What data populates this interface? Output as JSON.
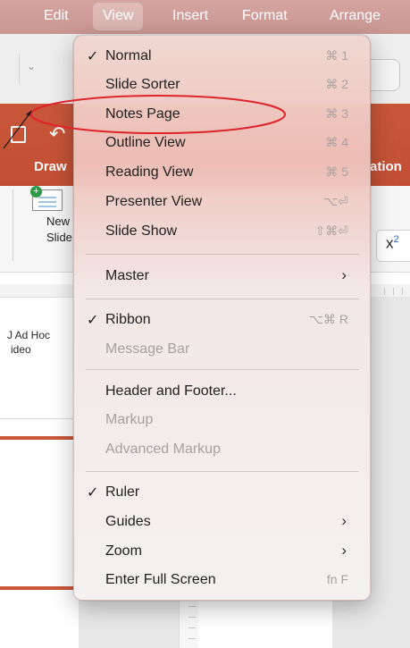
{
  "menubar": {
    "items": [
      {
        "label": "Edit"
      },
      {
        "label": "View"
      },
      {
        "label": "Insert"
      },
      {
        "label": "Format"
      },
      {
        "label": "Arrange"
      }
    ]
  },
  "ribbon": {
    "tab_draw": "Draw",
    "tab_animations_partial": "ation",
    "new_slide_label_1": "New",
    "new_slide_label_2": "Slide",
    "superscript_glyph": "x",
    "superscript_exp": "2"
  },
  "slide_panel": {
    "caption_1": "J Ad Hoc",
    "caption_2": "ideo"
  },
  "view_menu": {
    "items": [
      {
        "label": "Normal",
        "checked": "✓",
        "shortcut": "⌘ 1"
      },
      {
        "label": "Slide Sorter",
        "shortcut": "⌘ 2"
      },
      {
        "label": "Notes Page",
        "shortcut": "⌘ 3",
        "highlighted": true
      },
      {
        "label": "Outline View",
        "shortcut": "⌘ 4"
      },
      {
        "label": "Reading View",
        "shortcut": "⌘ 5"
      },
      {
        "label": "Presenter View",
        "shortcut": "⌥⏎"
      },
      {
        "label": "Slide Show",
        "shortcut": "⇧⌘⏎"
      },
      {
        "label": "Master",
        "submenu": "›"
      },
      {
        "label": "Ribbon",
        "checked": "✓",
        "shortcut": "⌥⌘ R"
      },
      {
        "label": "Message Bar",
        "disabled": true
      },
      {
        "label": "Header and Footer..."
      },
      {
        "label": "Markup",
        "disabled": true
      },
      {
        "label": "Advanced Markup",
        "disabled": true
      },
      {
        "label": "Ruler",
        "checked": "✓"
      },
      {
        "label": "Guides",
        "submenu": "›"
      },
      {
        "label": "Zoom",
        "submenu": "›"
      },
      {
        "label": "Enter Full Screen",
        "shortcut": "fn F"
      }
    ]
  },
  "colors": {
    "menubar": "#cc9893",
    "ribbon_accent": "#c24f33",
    "annotation_red": "#e0232a"
  }
}
